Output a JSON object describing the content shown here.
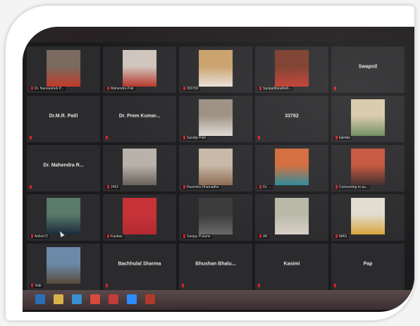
{
  "participants": [
    {
      "id": "p1",
      "label": "Dr. Nanasaheb P...",
      "name": "",
      "video": true,
      "colors": [
        "#7a6a60",
        "#c13a2a"
      ]
    },
    {
      "id": "p2",
      "label": "Mahendra Pati",
      "name": "",
      "video": true,
      "colors": [
        "#cfc5bd",
        "#b8362a"
      ]
    },
    {
      "id": "p3",
      "label": "033782",
      "name": "",
      "video": true,
      "colors": [
        "#c9a06a",
        "#e8e0d6"
      ]
    },
    {
      "id": "p4",
      "label": "SanjayMarathe0...",
      "name": "",
      "video": true,
      "colors": [
        "#7a3a2a",
        "#c43a2e"
      ]
    },
    {
      "id": "p5",
      "label": "",
      "name": "Swapnil",
      "video": false,
      "colors": []
    },
    {
      "id": "p6",
      "label": "",
      "name": "Dr.M.R. Patil",
      "video": false,
      "colors": []
    },
    {
      "id": "p7",
      "label": "",
      "name": "Dr. Prem Kumar...",
      "video": false,
      "colors": []
    },
    {
      "id": "p8",
      "label": "Sandip Patil",
      "name": "",
      "video": true,
      "colors": [
        "#9b8f80",
        "#e0dcd6"
      ]
    },
    {
      "id": "p9",
      "label": "",
      "name": "33782",
      "video": false,
      "colors": []
    },
    {
      "id": "p10",
      "label": "kalmbe",
      "name": "",
      "video": true,
      "colors": [
        "#d8c8a8",
        "#6a8a5a"
      ]
    },
    {
      "id": "p11",
      "label": "",
      "name": "Dr. Mahendra R...",
      "video": false,
      "colors": []
    },
    {
      "id": "p12",
      "label": "2453",
      "name": "",
      "video": true,
      "colors": [
        "#b9b2ab",
        "#6a625c"
      ]
    },
    {
      "id": "p13",
      "label": "Ravindra Dhamadhe",
      "name": "",
      "video": true,
      "colors": [
        "#c7b8a6",
        "#8a6a50"
      ]
    },
    {
      "id": "p14",
      "label": "Dr. ...",
      "name": "",
      "video": true,
      "colors": [
        "#d26a3a",
        "#2a8a9a"
      ]
    },
    {
      "id": "p15",
      "label": "Connecting to au...",
      "name": "",
      "video": true,
      "colors": [
        "#c4533a",
        "#3a2a2a"
      ]
    },
    {
      "id": "p16",
      "label": "Aniket D",
      "name": "",
      "video": true,
      "colors": [
        "#5a7a6a",
        "#1a2a3a"
      ]
    },
    {
      "id": "p17",
      "label": "Kasbas",
      "name": "",
      "video": true,
      "colors": [
        "#c73238",
        "#b22a30"
      ]
    },
    {
      "id": "p18",
      "label": "Sanjay Pusane",
      "name": "",
      "video": true,
      "colors": [
        "#3a3a3a",
        "#6a6a6a"
      ]
    },
    {
      "id": "p19",
      "label": "AK",
      "name": "",
      "video": true,
      "colors": [
        "#b8b8a8",
        "#d8d0c8"
      ]
    },
    {
      "id": "p20",
      "label": "MAG",
      "name": "",
      "video": true,
      "colors": [
        "#e0dcd0",
        "#d9a43a"
      ]
    },
    {
      "id": "p21",
      "label": "Vaib",
      "name": "",
      "video": true,
      "colors": [
        "#6a8aa8",
        "#5a4a3a"
      ]
    },
    {
      "id": "p22",
      "label": "",
      "name": "Bachhulal Sharma",
      "video": false,
      "colors": []
    },
    {
      "id": "p23",
      "label": "",
      "name": "Bhushan Bhalu...",
      "video": false,
      "colors": []
    },
    {
      "id": "p24",
      "label": "",
      "name": "Kasimi",
      "video": false,
      "colors": []
    },
    {
      "id": "p25",
      "label": "",
      "name": "Pap",
      "video": false,
      "colors": []
    }
  ],
  "taskbar": {
    "icons": [
      {
        "name": "windows-start-icon",
        "color": "#2a6fb5"
      },
      {
        "name": "explorer-icon",
        "color": "#d8b34a"
      },
      {
        "name": "browser-icon",
        "color": "#3b8fd0"
      },
      {
        "name": "chrome-icon",
        "color": "#d84a3a"
      },
      {
        "name": "media-icon",
        "color": "#c23a3a"
      },
      {
        "name": "zoom-icon",
        "color": "#2d8cff"
      },
      {
        "name": "app-icon",
        "color": "#b03a2e"
      }
    ]
  },
  "colors": {
    "mic_muted": "#d4232a",
    "tile_bg": "#2b2b2d"
  }
}
